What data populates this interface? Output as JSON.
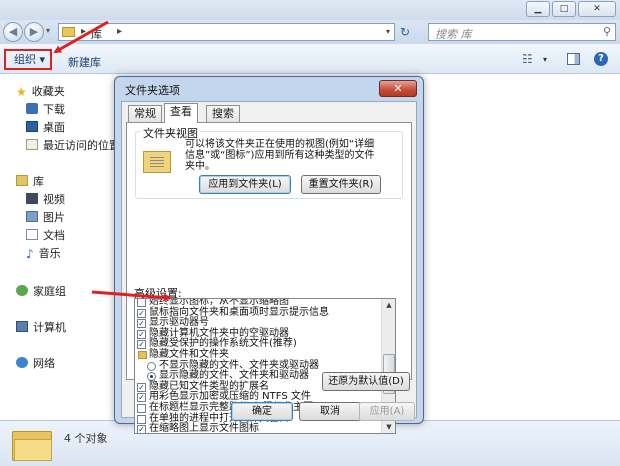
{
  "window": {
    "minimize_glyph": "▁",
    "maximize_glyph": "□",
    "close_glyph": "✕"
  },
  "address": {
    "back_glyph": "◀",
    "forward_glyph": "▶",
    "breadcrumb_sep": "▸",
    "location": "库",
    "search_placeholder": "搜索 库",
    "search_icon": "search-icon",
    "search_glyph": "⚲",
    "refresh_glyph": "↻"
  },
  "toolbar": {
    "organize": "组织 ▾",
    "new_library": "新建库",
    "views_glyph": "☷",
    "dropdown_glyph": "▾",
    "help_glyph": "?"
  },
  "nav": {
    "favorites": "收藏夹",
    "downloads": "下载",
    "desktop": "桌面",
    "recent": "最近访问的位置",
    "libraries": "库",
    "videos": "视频",
    "pictures": "图片",
    "documents": "文档",
    "music": "音乐",
    "homegroup": "家庭组",
    "computer": "计算机",
    "network": "网络"
  },
  "status": {
    "count": "4 个对象"
  },
  "dialog": {
    "title": "文件夹选项",
    "close_glyph": "✕",
    "tabs": {
      "general": "常规",
      "view": "查看",
      "search": "搜索"
    },
    "folder_views": {
      "label": "文件夹视图",
      "description": "可以将该文件夹正在使用的视图(例如“详细信息”或“图标”)应用到所有这种类型的文件夹中。",
      "apply_button": "应用到文件夹(L)",
      "reset_button": "重置文件夹(R)"
    },
    "advanced_label": "高级设置:",
    "advanced_items": [
      {
        "type": "checkbox",
        "checked": false,
        "label": "始终显示图标，从不显示缩略图"
      },
      {
        "type": "checkbox",
        "checked": true,
        "label": "鼠标指向文件夹和桌面项时显示提示信息"
      },
      {
        "type": "checkbox",
        "checked": true,
        "label": "显示驱动器号"
      },
      {
        "type": "checkbox",
        "checked": true,
        "label": "隐藏计算机文件夹中的空驱动器"
      },
      {
        "type": "checkbox",
        "checked": true,
        "label": "隐藏受保护的操作系统文件(推荐)"
      },
      {
        "type": "folder",
        "checked": false,
        "label": "隐藏文件和文件夹"
      },
      {
        "type": "radio",
        "checked": false,
        "label": "不显示隐藏的文件、文件夹或驱动器"
      },
      {
        "type": "radio",
        "checked": true,
        "label": "显示隐藏的文件、文件夹和驱动器"
      },
      {
        "type": "checkbox",
        "checked": true,
        "label": "隐藏已知文件类型的扩展名"
      },
      {
        "type": "checkbox",
        "checked": true,
        "label": "用彩色显示加密或压缩的 NTFS 文件"
      },
      {
        "type": "checkbox",
        "checked": false,
        "label": "在标题栏显示完整路径(仅限经典主题)"
      },
      {
        "type": "checkbox",
        "checked": false,
        "label": "在单独的进程中打开文件夹窗口"
      },
      {
        "type": "checkbox",
        "checked": true,
        "label": "在缩略图上显示文件图标"
      }
    ],
    "restore_defaults": "还原为默认值(D)",
    "ok": "确定",
    "cancel": "取消",
    "apply": "应用(A)"
  }
}
